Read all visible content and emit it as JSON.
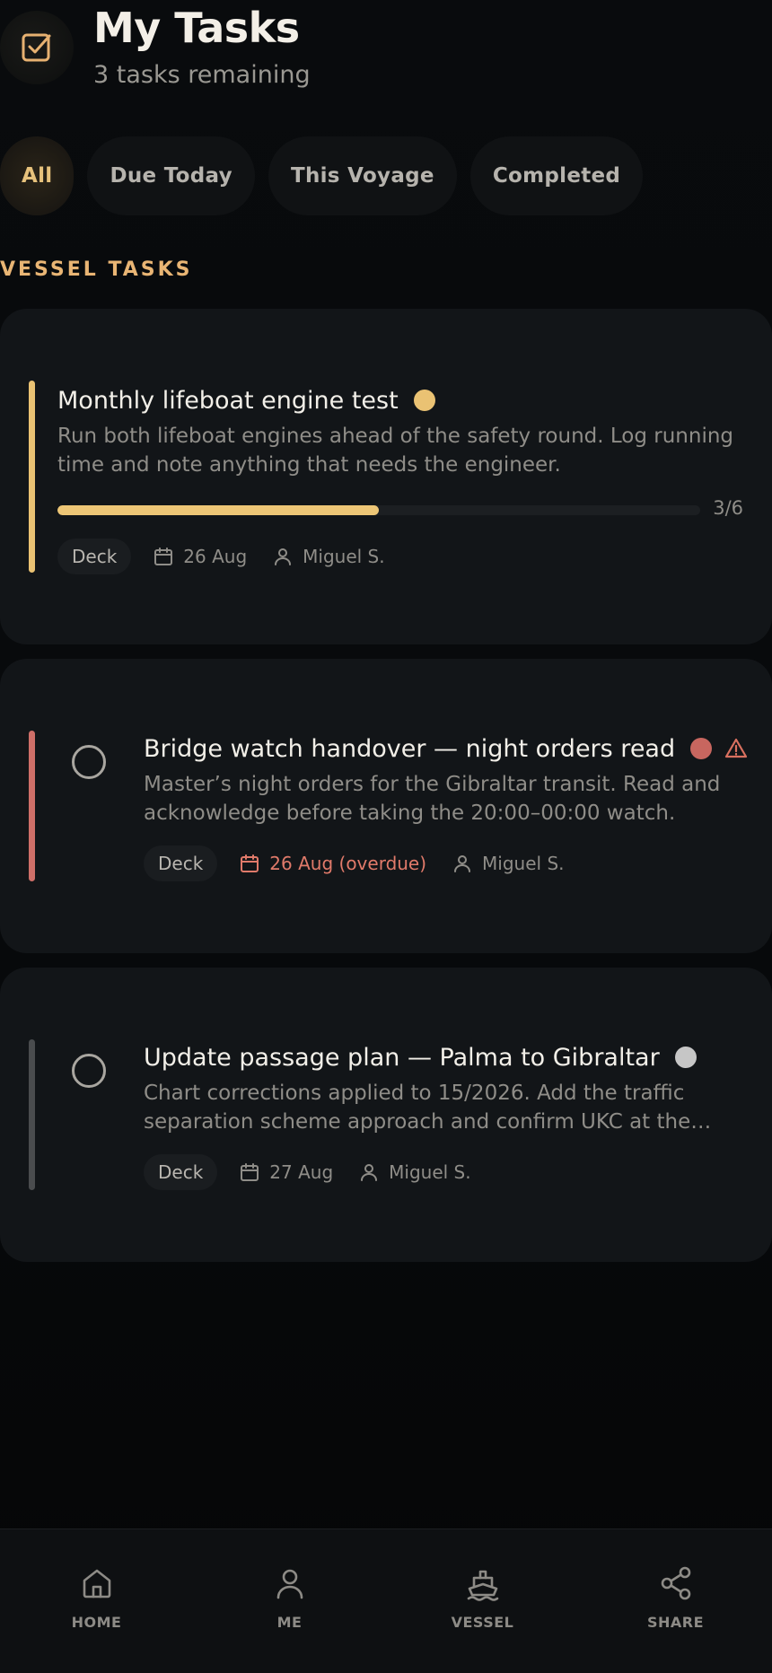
{
  "header": {
    "title": "My Tasks",
    "subtitle": "3 tasks remaining",
    "icon": "checkbox-icon",
    "accent_color": "#e7b171"
  },
  "filters": [
    {
      "label": "All",
      "active": true
    },
    {
      "label": "Due Today",
      "active": false
    },
    {
      "label": "This Voyage",
      "active": false
    },
    {
      "label": "Completed",
      "active": false
    }
  ],
  "section": {
    "label": "VESSEL TASKS"
  },
  "tasks": [
    {
      "title": "Monthly lifeboat engine test",
      "description": "Run both lifeboat engines ahead of the safety round. Log running time and note anything that needs the engineer.",
      "accent_color": "#eac273",
      "priority_color": "#eac273",
      "progress_done": 3,
      "progress_total": 6,
      "progress_label": "3/6",
      "tag": "Deck",
      "due": "26 Aug",
      "assignee": "Miguel S.",
      "overdue": false,
      "warning": false
    },
    {
      "title": "Bridge watch handover — night orders read",
      "description": "Master’s night orders for the Gibraltar transit. Read and acknowledge before taking the 20:00–00:00 watch.",
      "accent_color": "#cf6f68",
      "priority_color": "#c8665f",
      "tag": "Deck",
      "due": "26 Aug (overdue)",
      "assignee": "Miguel S.",
      "overdue": true,
      "warning": true,
      "warning_icon": "warning-triangle-icon"
    },
    {
      "title": "Update passage plan — Palma to Gibraltar",
      "description": "Chart corrections applied to 15/2026. Add the traffic separation scheme approach and confirm UKC at the…",
      "accent_color": "#4a4c4e",
      "priority_color": "#c6c6c6",
      "tag": "Deck",
      "due": "27 Aug",
      "assignee": "Miguel S.",
      "overdue": false,
      "warning": false
    }
  ],
  "nav": [
    {
      "label": "HOME",
      "icon": "home-icon"
    },
    {
      "label": "ME",
      "icon": "person-icon"
    },
    {
      "label": "VESSEL",
      "icon": "ship-icon"
    },
    {
      "label": "SHARE",
      "icon": "share-icon"
    }
  ]
}
